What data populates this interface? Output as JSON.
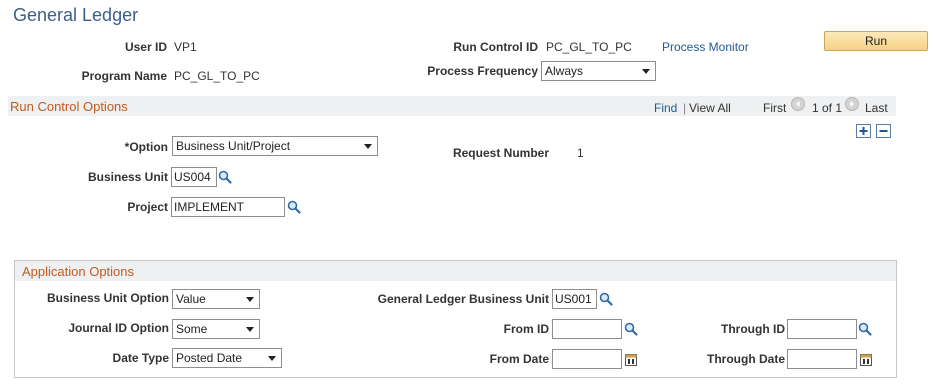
{
  "page_title": "General Ledger",
  "header": {
    "user_id_label": "User ID",
    "user_id_value": "VP1",
    "run_control_label": "Run Control ID",
    "run_control_value": "PC_GL_TO_PC",
    "process_monitor_link": "Process Monitor",
    "run_button": "Run",
    "program_name_label": "Program Name",
    "program_name_value": "PC_GL_TO_PC",
    "process_frequency_label": "Process Frequency",
    "process_frequency_value": "Always"
  },
  "run_control_options": {
    "title": "Run Control Options",
    "find_link": "Find",
    "separator": "|",
    "view_all_link": "View All",
    "first_label": "First",
    "page_indicator": "1 of 1",
    "last_label": "Last",
    "option_label": "*Option",
    "option_value": "Business Unit/Project",
    "request_number_label": "Request Number",
    "request_number_value": "1",
    "business_unit_label": "Business Unit",
    "business_unit_value": "US004",
    "project_label": "Project",
    "project_value": "IMPLEMENT"
  },
  "application_options": {
    "title": "Application Options",
    "bu_option_label": "Business Unit Option",
    "bu_option_value": "Value",
    "gl_bu_label": "General Ledger Business Unit",
    "gl_bu_value": "US001",
    "journal_option_label": "Journal ID Option",
    "journal_option_value": "Some",
    "from_id_label": "From ID",
    "from_id_value": "",
    "through_id_label": "Through ID",
    "through_id_value": "",
    "date_type_label": "Date Type",
    "date_type_value": "Posted Date",
    "from_date_label": "From Date",
    "from_date_value": "",
    "through_date_label": "Through Date",
    "through_date_value": ""
  }
}
